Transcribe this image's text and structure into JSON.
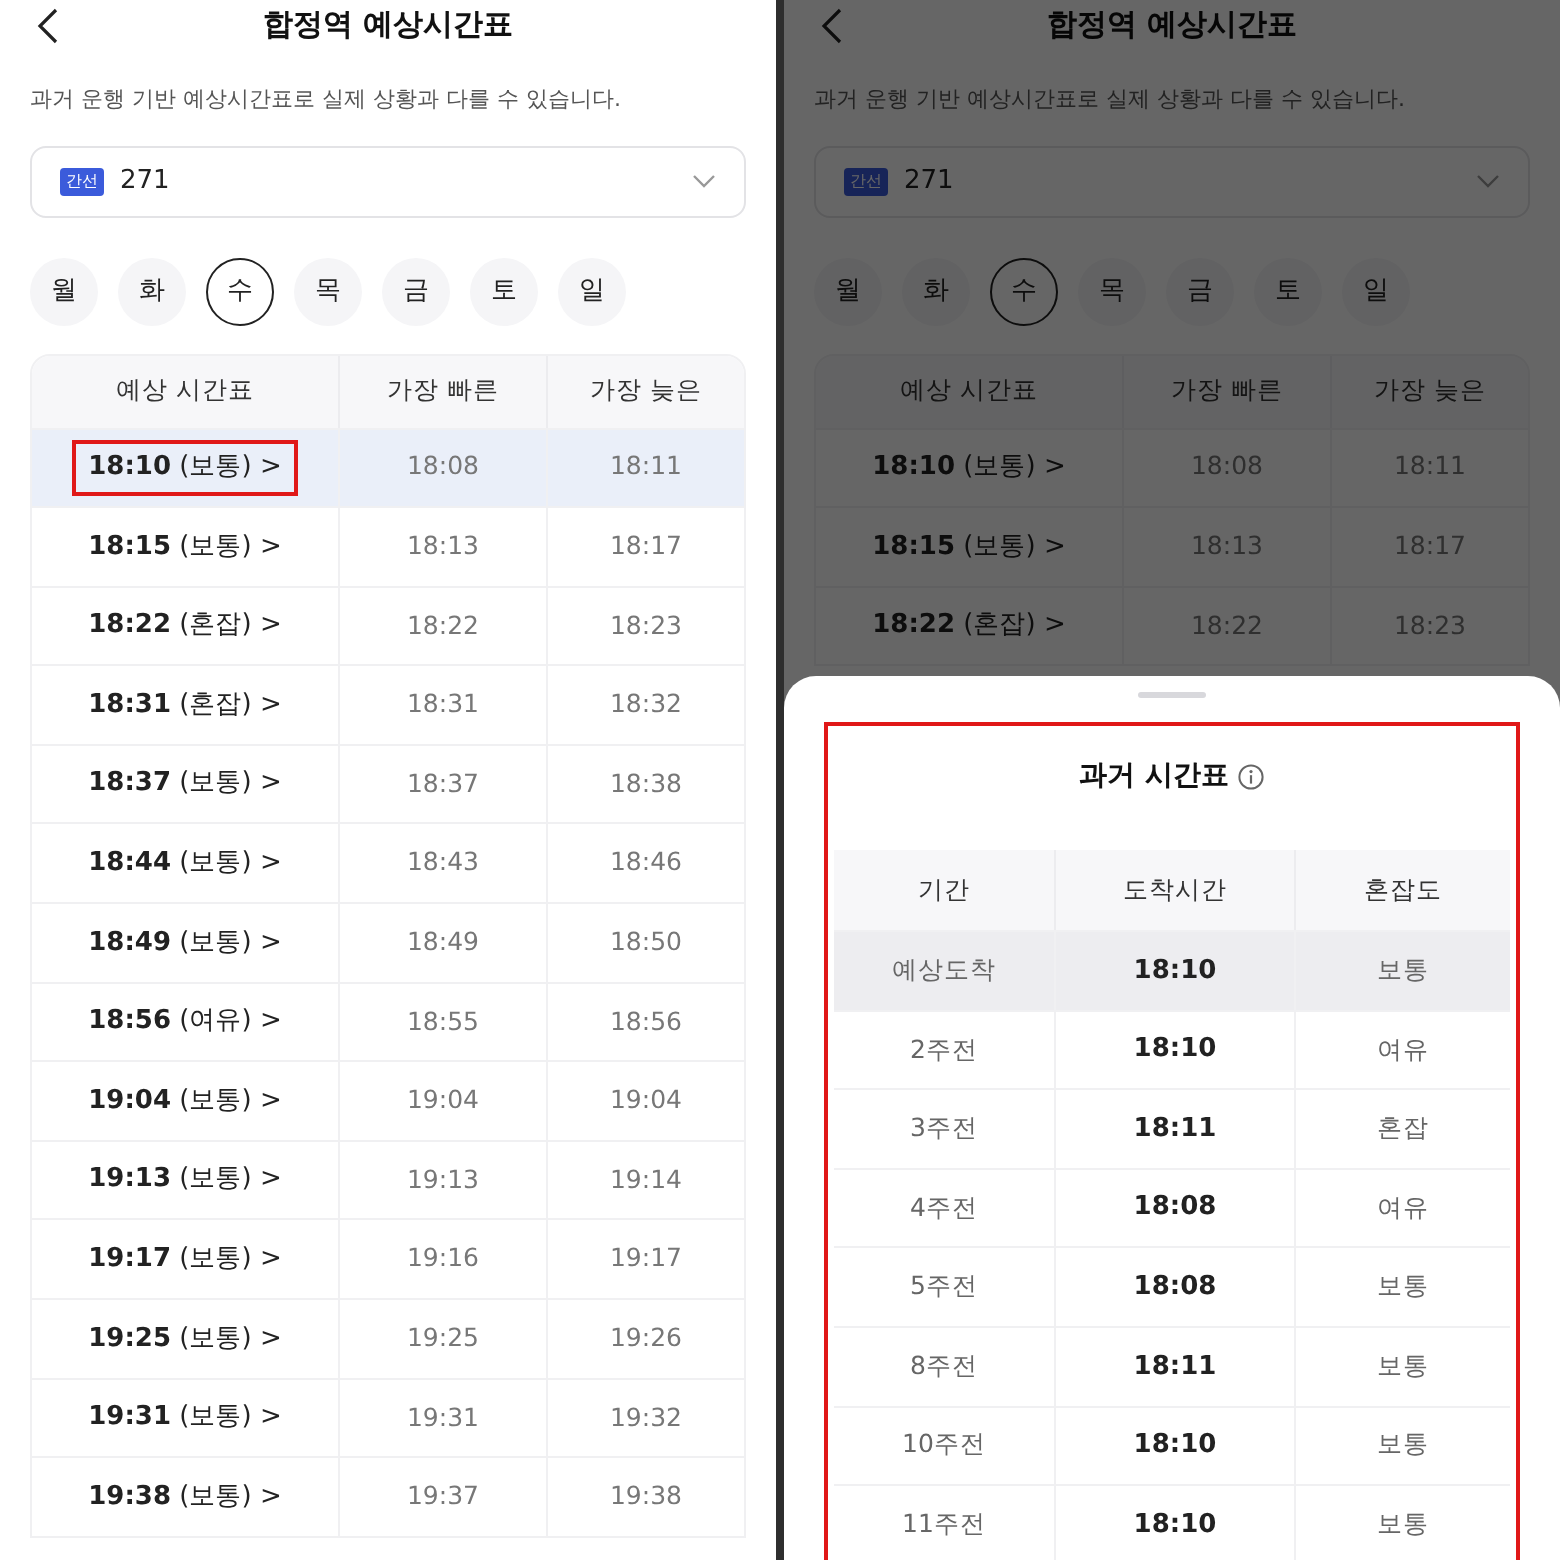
{
  "screens": [
    {
      "title": "합정역 예상시간표",
      "notice": "과거 운행 기반 예상시간표로 실제 상황과 다를 수 있습니다.",
      "route": {
        "badge": "간선",
        "number": "271"
      },
      "days": [
        {
          "label": "월",
          "selected": false
        },
        {
          "label": "화",
          "selected": false
        },
        {
          "label": "수",
          "selected": true
        },
        {
          "label": "목",
          "selected": false
        },
        {
          "label": "금",
          "selected": false
        },
        {
          "label": "토",
          "selected": false
        },
        {
          "label": "일",
          "selected": false
        }
      ],
      "table": {
        "columns": [
          "예상 시간표",
          "가장 빠른",
          "가장 늦은"
        ],
        "rows": [
          {
            "time": "**18:10** (보통) >",
            "earliest": "18:08",
            "latest": "18:11",
            "selected": true,
            "annotated": true
          },
          {
            "time": "**18:15** (보통) >",
            "earliest": "18:13",
            "latest": "18:17",
            "selected": false,
            "annotated": false
          },
          {
            "time": "**18:22** (혼잡) >",
            "earliest": "18:22",
            "latest": "18:23",
            "selected": false,
            "annotated": false
          },
          {
            "time": "**18:31** (혼잡) >",
            "earliest": "18:31",
            "latest": "18:32",
            "selected": false,
            "annotated": false
          },
          {
            "time": "**18:37** (보통) >",
            "earliest": "18:37",
            "latest": "18:38",
            "selected": false,
            "annotated": false
          },
          {
            "time": "**18:44** (보통) >",
            "earliest": "18:43",
            "latest": "18:46",
            "selected": false,
            "annotated": false
          },
          {
            "time": "**18:49** (보통) >",
            "earliest": "18:49",
            "latest": "18:50",
            "selected": false,
            "annotated": false
          },
          {
            "time": "**18:56** (여유) >",
            "earliest": "18:55",
            "latest": "18:56",
            "selected": false,
            "annotated": false
          },
          {
            "time": "**19:04** (보통) >",
            "earliest": "19:04",
            "latest": "19:04",
            "selected": false,
            "annotated": false
          },
          {
            "time": "**19:13** (보통) >",
            "earliest": "19:13",
            "latest": "19:14",
            "selected": false,
            "annotated": false
          },
          {
            "time": "**19:17** (보통) >",
            "earliest": "19:16",
            "latest": "19:17",
            "selected": false,
            "annotated": false
          },
          {
            "time": "**19:25** (보통) >",
            "earliest": "19:25",
            "latest": "19:26",
            "selected": false,
            "annotated": false
          },
          {
            "time": "**19:31** (보통) >",
            "earliest": "19:31",
            "latest": "19:32",
            "selected": false,
            "annotated": false
          },
          {
            "time": "**19:38** (보통) >",
            "earliest": "19:37",
            "latest": "19:38",
            "selected": false,
            "annotated": false
          }
        ]
      }
    },
    {
      "title": "합정역 예상시간표",
      "notice": "과거 운행 기반 예상시간표로 실제 상황과 다를 수 있습니다.",
      "route": {
        "badge": "간선",
        "number": "271"
      },
      "days": [
        {
          "label": "월",
          "selected": false
        },
        {
          "label": "화",
          "selected": false
        },
        {
          "label": "수",
          "selected": true
        },
        {
          "label": "목",
          "selected": false
        },
        {
          "label": "금",
          "selected": false
        },
        {
          "label": "토",
          "selected": false
        },
        {
          "label": "일",
          "selected": false
        }
      ],
      "table": {
        "columns": [
          "예상 시간표",
          "가장 빠른",
          "가장 늦은"
        ],
        "rows": [
          {
            "time": "**18:10** (보통) >",
            "earliest": "18:08",
            "latest": "18:11",
            "annotated": false
          },
          {
            "time": "**18:15** (보통) >",
            "earliest": "18:13",
            "latest": "18:17",
            "annotated": false
          },
          {
            "time": "**18:22** (혼잡) >",
            "earliest": "18:22",
            "latest": "18:23",
            "annotated": false
          }
        ]
      },
      "sheet": {
        "title": "과거 시간표",
        "annotated": true,
        "columns": [
          "기간",
          "도착시간",
          "혼잡도"
        ],
        "rows": [
          {
            "period": "예상도착",
            "arrival": "18:10",
            "congestion": "보통",
            "selected": true
          },
          {
            "period": "2주전",
            "arrival": "18:10",
            "congestion": "여유",
            "selected": false
          },
          {
            "period": "3주전",
            "arrival": "18:11",
            "congestion": "혼잡",
            "selected": false
          },
          {
            "period": "4주전",
            "arrival": "18:08",
            "congestion": "여유",
            "selected": false
          },
          {
            "period": "5주전",
            "arrival": "18:08",
            "congestion": "보통",
            "selected": false
          },
          {
            "period": "8주전",
            "arrival": "18:11",
            "congestion": "보통",
            "selected": false
          },
          {
            "period": "10주전",
            "arrival": "18:10",
            "congestion": "보통",
            "selected": false
          },
          {
            "period": "11주전",
            "arrival": "18:10",
            "congestion": "보통",
            "selected": false
          }
        ]
      }
    }
  ]
}
